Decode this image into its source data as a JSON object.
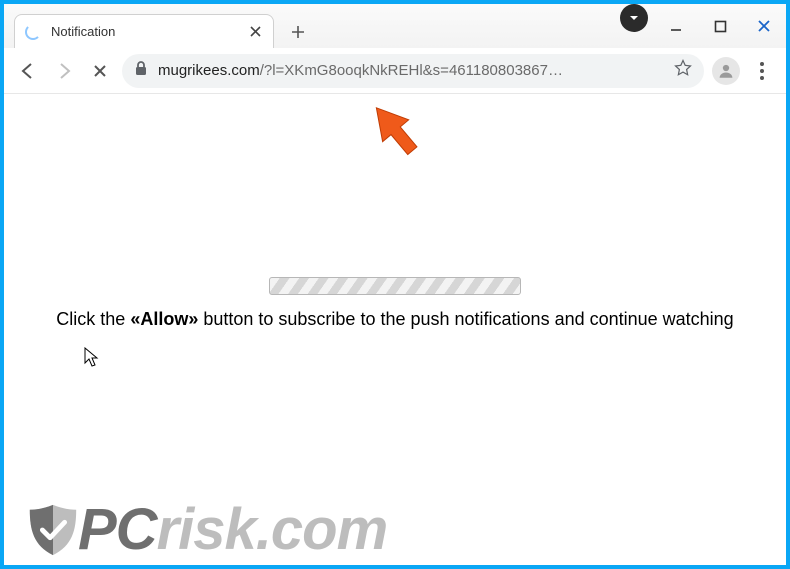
{
  "window": {
    "tab_title": "Notification",
    "profile_dropdown_icon": "chevron-down"
  },
  "toolbar": {
    "url_domain": "mugrikees.com",
    "url_rest": "/?l=XKmG8ooqkNkREHl&s=461180803867…"
  },
  "page": {
    "message_prefix": "Click the ",
    "message_allow": "«Allow»",
    "message_suffix": " button to subscribe to the push notifications and continue watching"
  },
  "watermark": {
    "part1": "PC",
    "part2": "risk.com"
  },
  "annotations": {
    "arrow_color": "#ef5a1a"
  }
}
